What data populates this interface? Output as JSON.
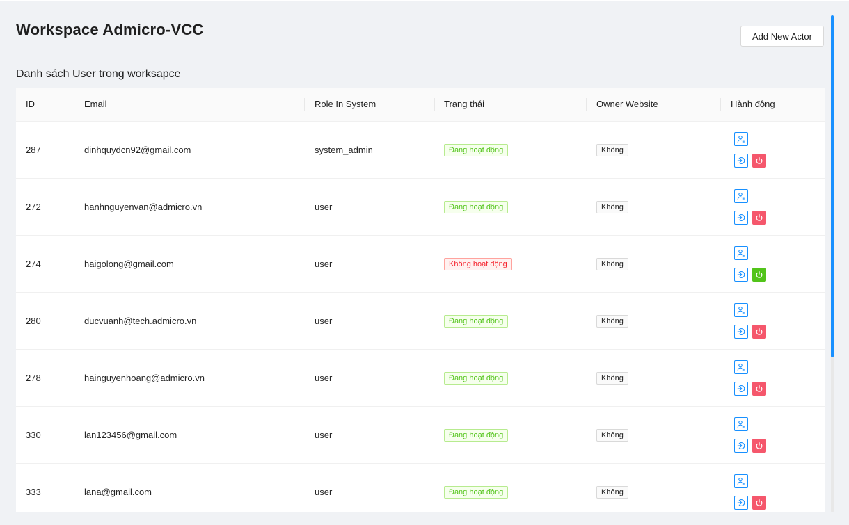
{
  "page": {
    "title": "Workspace Admicro-VCC",
    "add_button_label": "Add New Actor",
    "section_title": "Danh sách User trong worksapce"
  },
  "table": {
    "columns": [
      "ID",
      "Email",
      "Role In System",
      "Trạng thái",
      "Owner Website",
      "Hành động"
    ],
    "rows": [
      {
        "id": "287",
        "email": "dinhquydcn92@gmail.com",
        "role": "system_admin",
        "status": "Đang hoạt động",
        "status_type": "active",
        "owner": "Không",
        "power_state": "red"
      },
      {
        "id": "272",
        "email": "hanhnguyenvan@admicro.vn",
        "role": "user",
        "status": "Đang hoạt động",
        "status_type": "active",
        "owner": "Không",
        "power_state": "red"
      },
      {
        "id": "274",
        "email": "haigolong@gmail.com",
        "role": "user",
        "status": "Không hoạt động",
        "status_type": "inactive",
        "owner": "Không",
        "power_state": "green"
      },
      {
        "id": "280",
        "email": "ducvuanh@tech.admicro.vn",
        "role": "user",
        "status": "Đang hoạt động",
        "status_type": "active",
        "owner": "Không",
        "power_state": "red"
      },
      {
        "id": "278",
        "email": "hainguyenhoang@admicro.vn",
        "role": "user",
        "status": "Đang hoạt động",
        "status_type": "active",
        "owner": "Không",
        "power_state": "red"
      },
      {
        "id": "330",
        "email": "lan123456@gmail.com",
        "role": "user",
        "status": "Đang hoạt động",
        "status_type": "active",
        "owner": "Không",
        "power_state": "red"
      },
      {
        "id": "333",
        "email": "lana@gmail.com",
        "role": "user",
        "status": "Đang hoạt động",
        "status_type": "active",
        "owner": "Không",
        "power_state": "red"
      }
    ]
  },
  "icons": {
    "user": "user-edit-icon",
    "login": "login-icon",
    "power": "power-icon"
  },
  "colors": {
    "accent": "#1890ff",
    "active_green": "#52c41a",
    "inactive_red": "#f5222d",
    "power_red": "#f5576c"
  }
}
